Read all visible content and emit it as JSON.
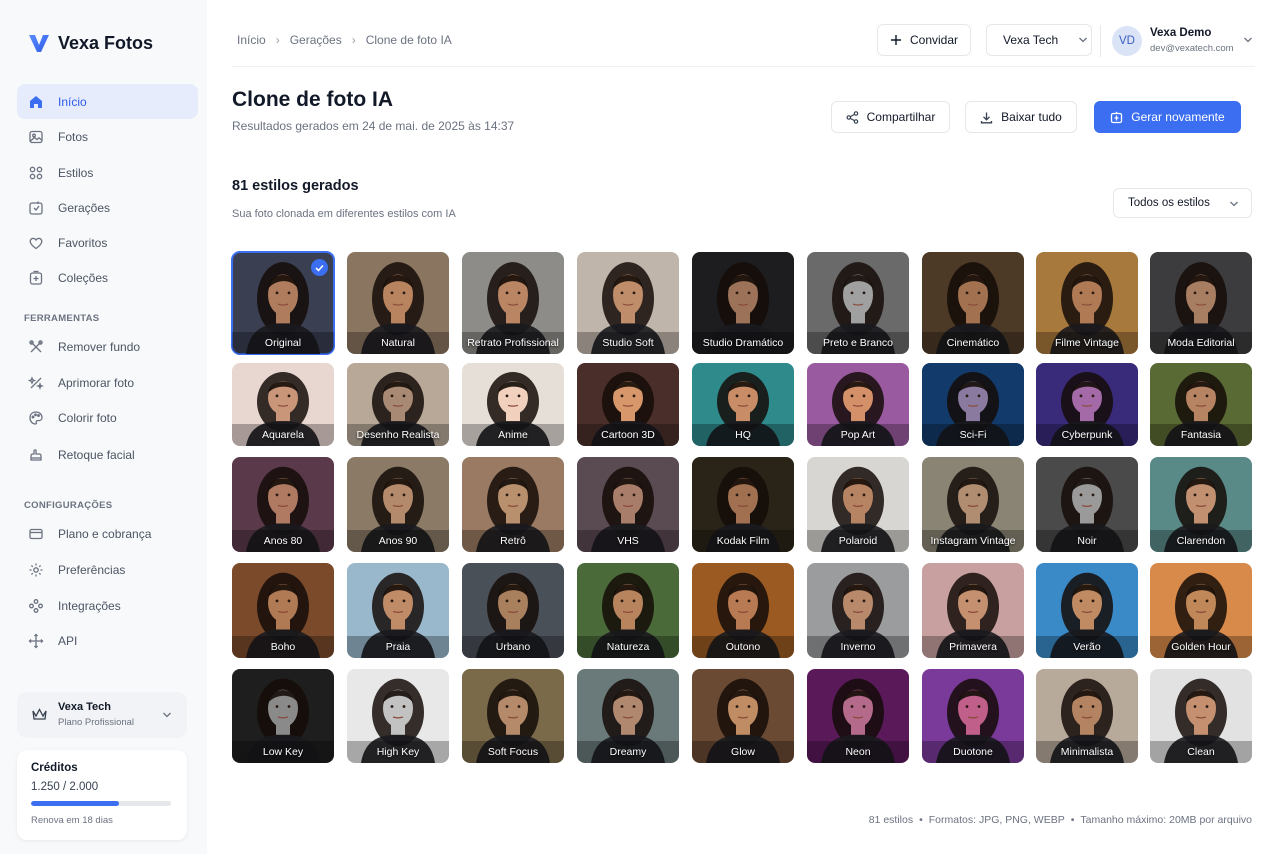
{
  "app": {
    "name": "Vexa Fotos"
  },
  "sidebar": {
    "main_items": [
      {
        "label": "Início",
        "icon": "home-icon"
      },
      {
        "label": "Fotos",
        "icon": "image-icon"
      },
      {
        "label": "Estilos",
        "icon": "grid-icon"
      },
      {
        "label": "Gerações",
        "icon": "generations-icon"
      },
      {
        "label": "Favoritos",
        "icon": "heart-icon"
      },
      {
        "label": "Coleções",
        "icon": "collection-icon"
      }
    ],
    "tools_label": "FERRAMENTAS",
    "tools_items": [
      {
        "label": "Remover fundo",
        "icon": "remove-bg-icon"
      },
      {
        "label": "Aprimorar foto",
        "icon": "enhance-icon"
      },
      {
        "label": "Colorir foto",
        "icon": "colorize-icon"
      },
      {
        "label": "Retoque facial",
        "icon": "retouch-icon"
      }
    ],
    "settings_label": "CONFIGURAÇÕES",
    "settings_items": [
      {
        "label": "Plano e cobrança",
        "icon": "billing-icon"
      },
      {
        "label": "Preferências",
        "icon": "settings-icon"
      },
      {
        "label": "Integrações",
        "icon": "integrations-icon"
      },
      {
        "label": "API",
        "icon": "api-icon"
      }
    ],
    "team": {
      "name": "Vexa Tech",
      "plan": "Plano Profissional"
    },
    "credits": {
      "title": "Créditos",
      "value": "1.250 / 2.000",
      "fraction": 0.625,
      "renew": "Renova em 18 dias"
    }
  },
  "header": {
    "breadcrumb": [
      "Início",
      "Gerações",
      "Clone de foto IA"
    ],
    "invite_label": "Convidar",
    "workspace": "Vexa Tech",
    "user": {
      "initials": "VD",
      "name": "Vexa Demo",
      "email": "dev@vexatech.com"
    }
  },
  "page": {
    "title": "Clone de foto IA",
    "subtitle": "Resultados gerados em 24 de mai. de 2025 às 14:37",
    "share_label": "Compartilhar",
    "download_label": "Baixar tudo",
    "regenerate_label": "Gerar novamente",
    "count_title": "81 estilos gerados",
    "count_subtitle": "Sua foto clonada em diferentes estilos com IA",
    "filter_value": "Todos os estilos"
  },
  "styles": [
    {
      "label": "Original",
      "bg": "#3a3f52",
      "skin": "#b07c5e",
      "selected": true
    },
    {
      "label": "Natural",
      "bg": "#8a7560",
      "skin": "#b8835f"
    },
    {
      "label": "Retrato Profissional",
      "bg": "#8e8c88",
      "skin": "#b98563"
    },
    {
      "label": "Studio Soft",
      "bg": "#bfb5ab",
      "skin": "#c08d6b"
    },
    {
      "label": "Studio Dramático",
      "bg": "#1d1d1f",
      "skin": "#9c7258"
    },
    {
      "label": "Preto e Branco",
      "bg": "#6a6a6a",
      "skin": "#a0a0a0"
    },
    {
      "label": "Cinemático",
      "bg": "#4d3a26",
      "skin": "#a27250"
    },
    {
      "label": "Filme Vintage",
      "bg": "#a8793c",
      "skin": "#b07a55"
    },
    {
      "label": "Moda Editorial",
      "bg": "#3c3c3e",
      "skin": "#a87e62"
    },
    {
      "label": "Aquarela",
      "bg": "#e8d6d0",
      "skin": "#c9967a"
    },
    {
      "label": "Desenho Realista",
      "bg": "#b8a898",
      "skin": "#a88a74"
    },
    {
      "label": "Anime",
      "bg": "#e6dfd8",
      "skin": "#f1d1bd"
    },
    {
      "label": "Cartoon 3D",
      "bg": "#4a2e2a",
      "skin": "#d8976b"
    },
    {
      "label": "HQ",
      "bg": "#2f8a8c",
      "skin": "#c88c66"
    },
    {
      "label": "Pop Art",
      "bg": "#9a5aa0",
      "skin": "#d49068"
    },
    {
      "label": "Sci-Fi",
      "bg": "#123a6a",
      "skin": "#8a7aa0"
    },
    {
      "label": "Cyberpunk",
      "bg": "#3a2a7a",
      "skin": "#a46aa8"
    },
    {
      "label": "Fantasia",
      "bg": "#5a6a34",
      "skin": "#b68462"
    },
    {
      "label": "Anos 80",
      "bg": "#5a3a4a",
      "skin": "#b07a62"
    },
    {
      "label": "Anos 90",
      "bg": "#8a7a66",
      "skin": "#b48a6c"
    },
    {
      "label": "Retrô",
      "bg": "#9a7a62",
      "skin": "#b8906e"
    },
    {
      "label": "VHS",
      "bg": "#5a4a52",
      "skin": "#a87e6a"
    },
    {
      "label": "Kodak Film",
      "bg": "#2a2418",
      "skin": "#a07050"
    },
    {
      "label": "Polaroid",
      "bg": "#d8d6d2",
      "skin": "#b68462"
    },
    {
      "label": "Instagram Vintage",
      "bg": "#8a8474",
      "skin": "#b08c70"
    },
    {
      "label": "Noir",
      "bg": "#4a4a4a",
      "skin": "#9a9a9a"
    },
    {
      "label": "Clarendon",
      "bg": "#5a8a88",
      "skin": "#c09070"
    },
    {
      "label": "Boho",
      "bg": "#7a4a2a",
      "skin": "#b07a54"
    },
    {
      "label": "Praia",
      "bg": "#9ab8cc",
      "skin": "#c08c68"
    },
    {
      "label": "Urbano",
      "bg": "#4a5058",
      "skin": "#a8805e"
    },
    {
      "label": "Natureza",
      "bg": "#4a6a3a",
      "skin": "#b8845e"
    },
    {
      "label": "Outono",
      "bg": "#9a5a22",
      "skin": "#b87a52"
    },
    {
      "label": "Inverno",
      "bg": "#9a9c9e",
      "skin": "#b8896a"
    },
    {
      "label": "Primavera",
      "bg": "#c8a0a0",
      "skin": "#c49070"
    },
    {
      "label": "Verão",
      "bg": "#3a8ac8",
      "skin": "#c08a62"
    },
    {
      "label": "Golden Hour",
      "bg": "#d88a4a",
      "skin": "#c08858"
    },
    {
      "label": "Low Key",
      "bg": "#1e1e1e",
      "skin": "#8a8a8a"
    },
    {
      "label": "High Key",
      "bg": "#e8e8e8",
      "skin": "#c2c2c2"
    },
    {
      "label": "Soft Focus",
      "bg": "#7a6a4a",
      "skin": "#b48a6a"
    },
    {
      "label": "Dreamy",
      "bg": "#6a7a7a",
      "skin": "#b08870"
    },
    {
      "label": "Glow",
      "bg": "#6a4a32",
      "skin": "#c08c64"
    },
    {
      "label": "Neon",
      "bg": "#5a1a5a",
      "skin": "#b46a8a"
    },
    {
      "label": "Duotone",
      "bg": "#7a3a9a",
      "skin": "#c0608a"
    },
    {
      "label": "Minimalista",
      "bg": "#b8aa9a",
      "skin": "#b48462"
    },
    {
      "label": "Clean",
      "bg": "#e2e2e2",
      "skin": "#c49070"
    }
  ],
  "footer": {
    "count": "81 estilos",
    "formats": "Formatos: JPG, PNG, WEBP",
    "max_size": "Tamanho máximo: 20MB por arquivo"
  },
  "colors": {
    "accent": "#3b6ef0",
    "active_nav_bg": "#e6ecfb"
  }
}
